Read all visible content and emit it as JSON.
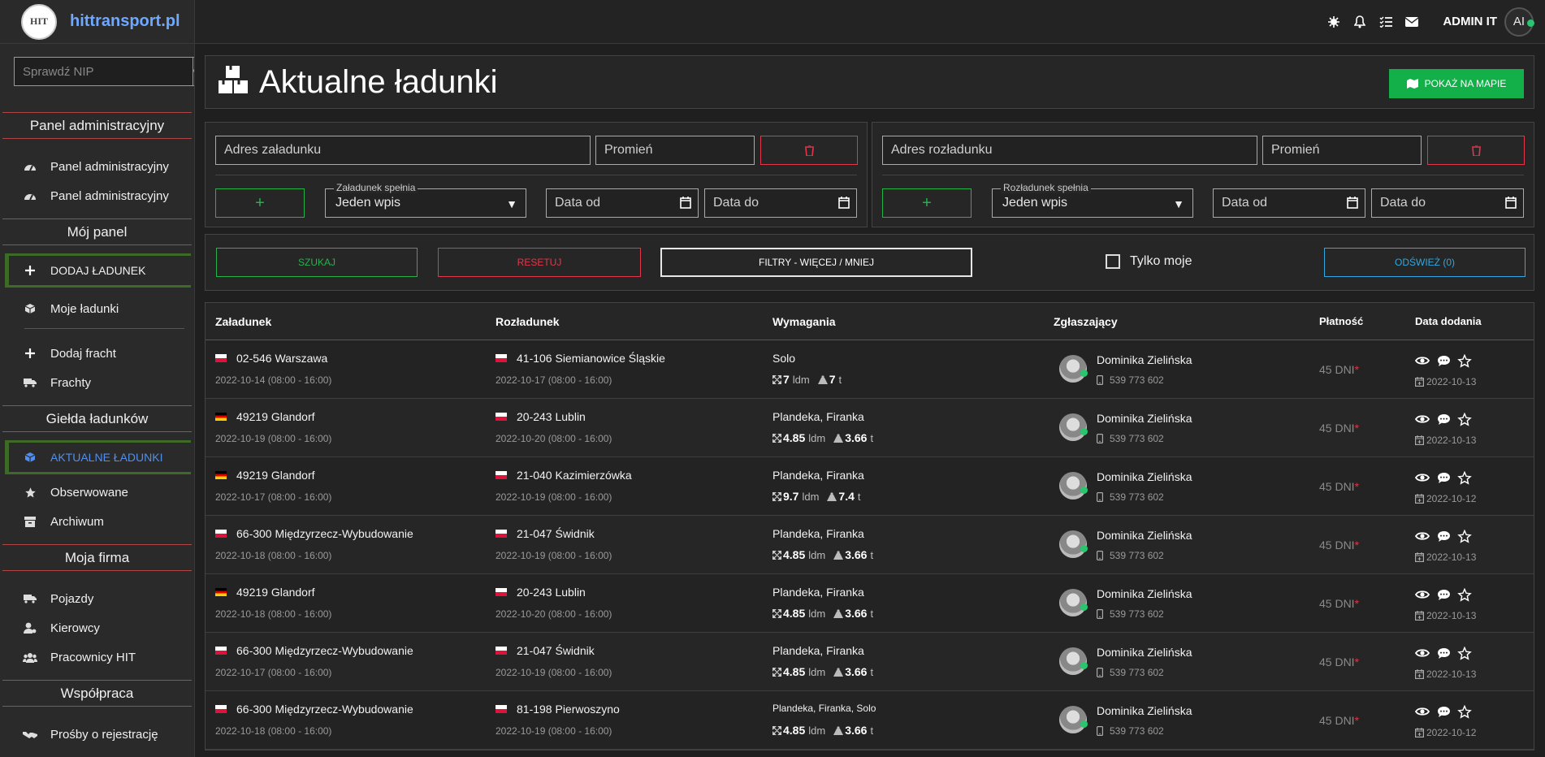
{
  "brand": {
    "name": "hittransport.pl",
    "logo_text": "HIT"
  },
  "nip": {
    "placeholder": "Sprawdź NIP"
  },
  "sidebar": {
    "sec1": "Panel administracyjny",
    "sec1_items": [
      "Panel administracyjny",
      "Panel administracyjny"
    ],
    "sec2": "Mój panel",
    "add_load": "DODAJ ŁADUNEK",
    "my_loads": "Moje ładunki",
    "add_freight": "Dodaj fracht",
    "freights": "Frachty",
    "sec3": "Giełda ładunków",
    "current_loads": "AKTUALNE ŁADUNKI",
    "watched": "Obserwowane",
    "archive": "Archiwum",
    "sec4": "Moja firma",
    "vehicles": "Pojazdy",
    "drivers": "Kierowcy",
    "employees": "Pracownicy HIT",
    "sec5": "Współpraca",
    "requests": "Prośby o rejestrację"
  },
  "topbar": {
    "admin": "ADMIN IT",
    "initials": "AI"
  },
  "page": {
    "title": "Aktualne ładunki",
    "map_btn": "POKAŻ NA MAPIE"
  },
  "loading": {
    "address": "Adres załadunku",
    "radius": "Promień",
    "match_legend": "Załadunek spełnia",
    "match_value": "Jeden wpis",
    "date_from": "Data od",
    "date_to": "Data do",
    "add": "+"
  },
  "unloading": {
    "address": "Adres rozładunku",
    "radius": "Promień",
    "match_legend": "Rozładunek spełnia",
    "match_value": "Jeden wpis",
    "date_from": "Data od",
    "date_to": "Data do",
    "add": "+"
  },
  "actions": {
    "search": "SZUKAJ",
    "reset": "RESETUJ",
    "filters": "FILTRY - WIĘCEJ / MNIEJ",
    "only_mine": "Tylko moje",
    "refresh": "ODŚWIEŻ (0)"
  },
  "colors": {
    "green": "#13b04a",
    "red": "#e2374a",
    "blue": "#2fa8e0",
    "accent_blue": "#4f8ef0"
  },
  "table": {
    "headers": [
      "Załadunek",
      "Rozładunek",
      "Wymagania",
      "Zgłaszający",
      "Płatność",
      "Data dodania"
    ],
    "ldm_unit": "ldm",
    "t_unit": "t",
    "rows": [
      {
        "from_flag": "pl",
        "from": "02-546 Warszawa",
        "from_date": "2022-10-14 (08:00 - 16:00)",
        "to_flag": "pl",
        "to": "41-106 Siemianowice Śląskie",
        "to_date": "2022-10-17 (08:00 - 16:00)",
        "req": "Solo",
        "ldm": "7",
        "t": "7",
        "person": "Dominika Zielińska",
        "phone": "539 773 602",
        "pay": "45 DNI",
        "added": "2022-10-13"
      },
      {
        "from_flag": "de",
        "from": "49219 Glandorf",
        "from_date": "2022-10-19 (08:00 - 16:00)",
        "to_flag": "pl",
        "to": "20-243 Lublin",
        "to_date": "2022-10-20 (08:00 - 16:00)",
        "req": "Plandeka, Firanka",
        "ldm": "4.85",
        "t": "3.66",
        "person": "Dominika Zielińska",
        "phone": "539 773 602",
        "pay": "45 DNI",
        "added": "2022-10-13"
      },
      {
        "from_flag": "de",
        "from": "49219 Glandorf",
        "from_date": "2022-10-17 (08:00 - 16:00)",
        "to_flag": "pl",
        "to": "21-040 Kazimierzówka",
        "to_date": "2022-10-19 (08:00 - 16:00)",
        "req": "Plandeka, Firanka",
        "ldm": "9.7",
        "t": "7.4",
        "person": "Dominika Zielińska",
        "phone": "539 773 602",
        "pay": "45 DNI",
        "added": "2022-10-12"
      },
      {
        "from_flag": "pl",
        "from": "66-300 Międzyrzecz-Wybudowanie",
        "from_date": "2022-10-18 (08:00 - 16:00)",
        "to_flag": "pl",
        "to": "21-047 Świdnik",
        "to_date": "2022-10-19 (08:00 - 16:00)",
        "req": "Plandeka, Firanka",
        "ldm": "4.85",
        "t": "3.66",
        "person": "Dominika Zielińska",
        "phone": "539 773 602",
        "pay": "45 DNI",
        "added": "2022-10-13"
      },
      {
        "from_flag": "de",
        "from": "49219 Glandorf",
        "from_date": "2022-10-18 (08:00 - 16:00)",
        "to_flag": "pl",
        "to": "20-243 Lublin",
        "to_date": "2022-10-20 (08:00 - 16:00)",
        "req": "Plandeka, Firanka",
        "ldm": "4.85",
        "t": "3.66",
        "person": "Dominika Zielińska",
        "phone": "539 773 602",
        "pay": "45 DNI",
        "added": "2022-10-13"
      },
      {
        "from_flag": "pl",
        "from": "66-300 Międzyrzecz-Wybudowanie",
        "from_date": "2022-10-17 (08:00 - 16:00)",
        "to_flag": "pl",
        "to": "21-047 Świdnik",
        "to_date": "2022-10-19 (08:00 - 16:00)",
        "req": "Plandeka, Firanka",
        "ldm": "4.85",
        "t": "3.66",
        "person": "Dominika Zielińska",
        "phone": "539 773 602",
        "pay": "45 DNI",
        "added": "2022-10-13"
      },
      {
        "from_flag": "pl",
        "from": "66-300 Międzyrzecz-Wybudowanie",
        "from_date": "2022-10-18 (08:00 - 16:00)",
        "to_flag": "pl",
        "to": "81-198 Pierwoszyno",
        "to_date": "2022-10-19 (08:00 - 16:00)",
        "req": "Plandeka, Firanka, Solo",
        "ldm": "4.85",
        "t": "3.66",
        "person": "Dominika Zielińska",
        "phone": "539 773 602",
        "pay": "45 DNI",
        "added": "2022-10-12"
      }
    ]
  }
}
